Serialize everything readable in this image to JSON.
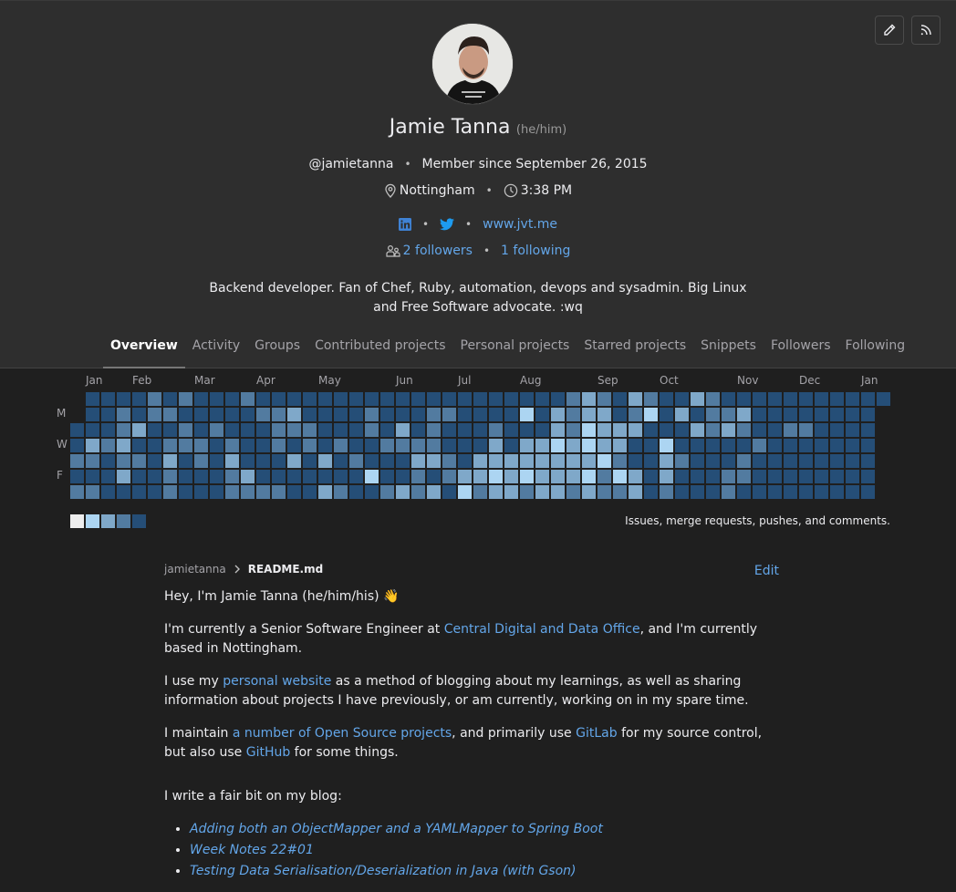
{
  "profile": {
    "name": "Jamie Tanna",
    "pronouns": "(he/him)",
    "username": "@jamietanna",
    "member_since": "Member since September 26, 2015",
    "location": "Nottingham",
    "local_time": "3:38 PM",
    "website": "www.jvt.me",
    "followers": "2 followers",
    "following": "1 following",
    "bio": "Backend developer. Fan of Chef, Ruby, automation, devops and sysadmin. Big Linux and Free Software advocate. :wq",
    "social_icons": [
      "linkedin-icon",
      "twitter-icon"
    ]
  },
  "actions": {
    "edit_icon": "pencil-icon",
    "rss_icon": "rss-icon"
  },
  "tabs": [
    {
      "label": "Overview",
      "active": true
    },
    {
      "label": "Activity"
    },
    {
      "label": "Groups"
    },
    {
      "label": "Contributed projects"
    },
    {
      "label": "Personal projects"
    },
    {
      "label": "Starred projects"
    },
    {
      "label": "Snippets"
    },
    {
      "label": "Followers"
    },
    {
      "label": "Following"
    }
  ],
  "calendar": {
    "months": [
      "Jan",
      "Feb",
      "Mar",
      "Apr",
      "May",
      "Jun",
      "Jul",
      "Aug",
      "Sep",
      "Oct",
      "Nov",
      "Dec",
      "Jan"
    ],
    "day_labels": [
      "M",
      "W",
      "F"
    ],
    "caption": "Issues, merge requests, pushes, and comments.",
    "colors": [
      "#ededed",
      "#acd5f2",
      "#7fa8c9",
      "#527ba0",
      "#254e77"
    ],
    "levels_by_row": [
      "-1111212111211111111111111111111232132113211111111111",
      "-112122111112231111211122111141323312413122311111111",
      "1112311212111222111213121112111324333111323211221111",
      "1323112221211212121122221113133434331141111121111111",
      "2212213121311131312111332133333333421132111211111111",
      "1113112111231111111411212334343334243131112211111111",
      "2211112111222211321123231423323323223121112111111111"
    ]
  },
  "readme": {
    "user": "jamietanna",
    "file": "README.md",
    "edit_label": "Edit",
    "greeting": "Hey, I'm Jamie Tanna (he/him/his) 👋",
    "p1_before": "I'm currently a Senior Software Engineer at ",
    "p1_link": "Central Digital and Data Office",
    "p1_after": ", and I'm currently based in Nottingham.",
    "p2_before": "I use my ",
    "p2_link": "personal website",
    "p2_after": " as a method of blogging about my learnings, as well as sharing information about projects I have previously, or am currently, working on in my spare time.",
    "p3_before": "I maintain ",
    "p3_link1": "a number of Open Source projects",
    "p3_mid": ", and primarily use ",
    "p3_link2": "GitLab",
    "p3_mid2": " for my source control, but also use ",
    "p3_link3": "GitHub",
    "p3_after": " for some things.",
    "blog_intro": "I write a fair bit on my blog:",
    "blog_posts": [
      "Adding both an ObjectMapper and a YAMLMapper to Spring Boot",
      "Week Notes 22#01",
      "Testing Data Serialisation/Deserialization in Java (with Gson)"
    ]
  }
}
